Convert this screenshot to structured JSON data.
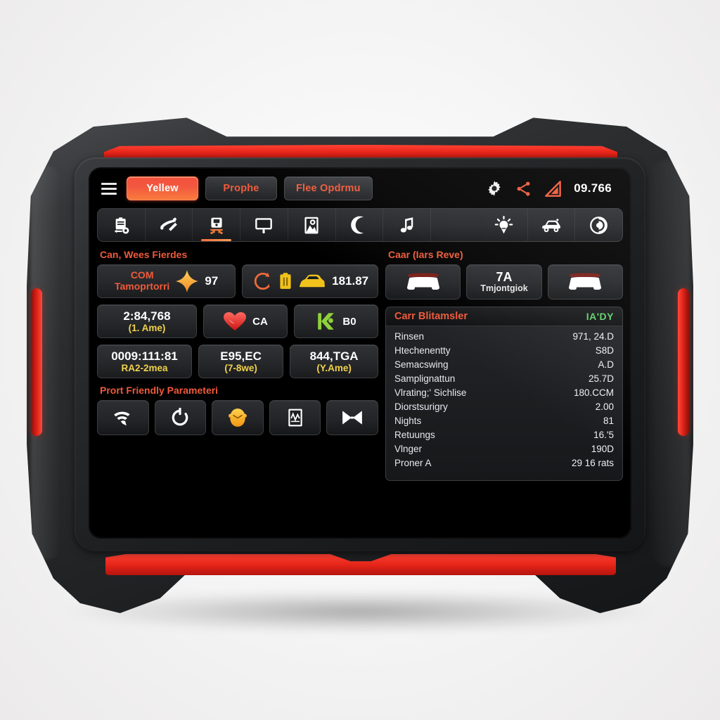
{
  "device": {
    "brand_accent": "#e8261b",
    "body_color": "#2a2c2e",
    "screen_bg": "#000000"
  },
  "topbar": {
    "menu_icon": "hamburger-menu-icon",
    "tabs": [
      {
        "label": "Yellew",
        "active": true
      },
      {
        "label": "Prophe",
        "active": false
      },
      {
        "label": "Flee Opdrmu",
        "active": false
      }
    ],
    "icons": [
      {
        "name": "gear-icon",
        "color": "#ffffff"
      },
      {
        "name": "share-icon",
        "color": "#ef5a3b"
      },
      {
        "name": "signal-strength-icon",
        "color": "#ef5a3b"
      }
    ],
    "signal_value": "09.766"
  },
  "toolbar": {
    "selected_index": 2,
    "items": [
      {
        "name": "battery-report-icon"
      },
      {
        "name": "tools-wrench-screwdriver-icon"
      },
      {
        "name": "car-lift-icon"
      },
      {
        "name": "monitor-display-icon"
      },
      {
        "name": "photo-image-icon"
      },
      {
        "name": "moon-icon"
      },
      {
        "name": "music-note-icon"
      },
      {
        "name": "bulb-light-icon"
      },
      {
        "name": "car-service-icon"
      },
      {
        "name": "target-spiral-icon"
      }
    ]
  },
  "left_panel": {
    "title": "Can, Wees Fierdes",
    "row1": [
      {
        "name": "com-monitor-card",
        "label_top": "COM",
        "label_bottom": "Tamoprtorri",
        "icon": "orange-diamond-icon",
        "value": "97"
      },
      {
        "name": "battery-charge-card",
        "icon_a": "recycle-arrow-icon",
        "icon_b": "battery-yellow-icon",
        "icon_c": "car-yellow-icon",
        "value": "181.87"
      }
    ],
    "row2": [
      {
        "name": "odometer-card",
        "value": "2:84,768",
        "sub": "(1. Ame)"
      },
      {
        "name": "heart-status-card",
        "icon": "red-heart-icon",
        "value": "CA"
      },
      {
        "name": "key-status-card",
        "icon": "green-key-icon",
        "value": "B0"
      }
    ],
    "row3": [
      {
        "name": "timer-card",
        "value": "0009:111:81",
        "sub": "RA2-2mea"
      },
      {
        "name": "fuel-card",
        "value": "E95,EC",
        "sub": "(7-8we)"
      },
      {
        "name": "mileage-card",
        "value": "844,TGA",
        "sub": "(Y.Ame)"
      }
    ],
    "params_title": "Prort Friendly Parameteri",
    "param_buttons": [
      {
        "name": "wifi-signal-icon"
      },
      {
        "name": "refresh-circle-icon"
      },
      {
        "name": "yellow-clock-icon"
      },
      {
        "name": "document-chart-icon"
      },
      {
        "name": "bowtie-valve-icon"
      }
    ]
  },
  "right_panel": {
    "title": "Caar (Iars Reve)",
    "cards": [
      {
        "name": "car-front-left-card",
        "icon": "car-front-icon"
      },
      {
        "name": "trajectory-card",
        "big": "7A",
        "sub": "Tmjontgiok"
      },
      {
        "name": "car-front-right-card",
        "icon": "car-front-icon"
      }
    ],
    "list_header": {
      "title": "Carr Blitamsler",
      "status": "IA'DY",
      "status_color": "#5fd06a"
    },
    "list_rows": [
      {
        "key": "Rinsen",
        "value": "971, 24.D"
      },
      {
        "key": "Htechenentty",
        "value": "S8D"
      },
      {
        "key": "Semacswing",
        "value": "A.D"
      },
      {
        "key": "Samplignattun",
        "value": "25.7D"
      },
      {
        "key": "Vlrating;' Sichlise",
        "value": "180.CCM"
      },
      {
        "key": "Diorstsurigry",
        "value": "2.00"
      },
      {
        "key": "Nights",
        "value": "81"
      },
      {
        "key": "Retuungs",
        "value": "16.'5"
      },
      {
        "key": "Vlnger",
        "value": "190D"
      },
      {
        "key": "Proner  A",
        "value": "29 16 rats"
      }
    ]
  }
}
